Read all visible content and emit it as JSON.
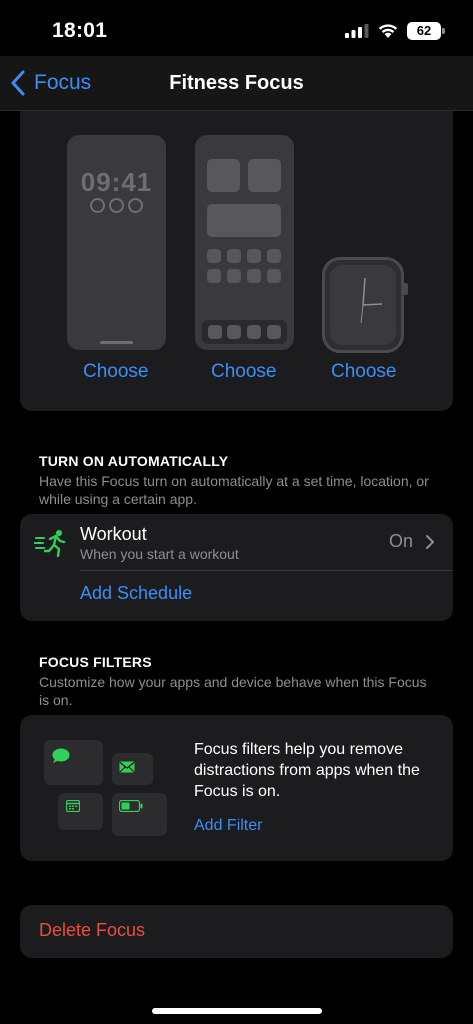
{
  "status_bar": {
    "time": "18:01",
    "battery": "62",
    "icons": [
      "signal-icon",
      "wifi-icon",
      "battery-icon"
    ]
  },
  "nav": {
    "back_label": "Focus",
    "title": "Fitness Focus"
  },
  "preview": {
    "lock_time": "09:41",
    "choose_labels": [
      "Choose",
      "Choose",
      "Choose"
    ]
  },
  "turn_on": {
    "header": "TURN ON AUTOMATICALLY",
    "description": "Have this Focus turn on automatically at a set time, location, or while using a certain app.",
    "workout": {
      "title": "Workout",
      "subtitle": "When you start a workout",
      "value": "On"
    },
    "add_schedule": "Add Schedule"
  },
  "filters": {
    "header": "FOCUS FILTERS",
    "description": "Customize how your apps and device behave when this Focus is on.",
    "body": "Focus filters help you remove distractions from apps when the Focus is on.",
    "add_filter": "Add Filter"
  },
  "delete": {
    "label": "Delete Focus"
  },
  "colors": {
    "accent": "#3a8ef6",
    "destructive": "#eb4d3d",
    "green": "#30d158"
  }
}
